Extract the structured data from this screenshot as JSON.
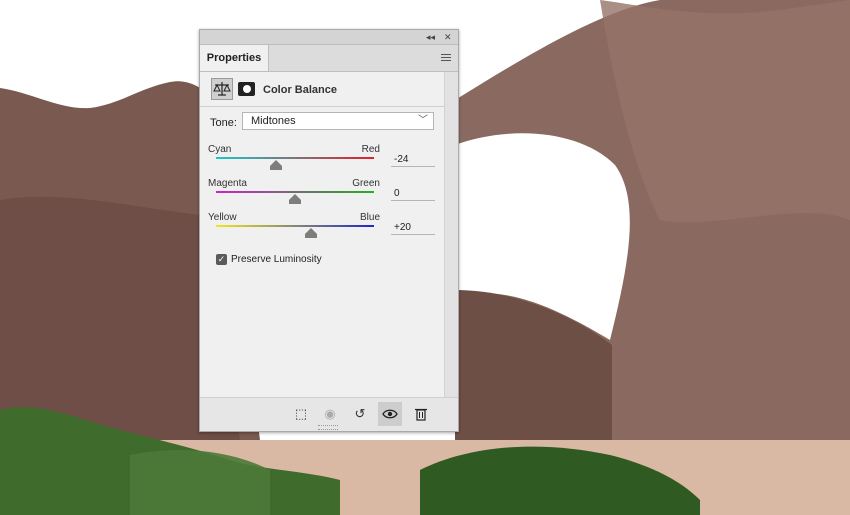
{
  "panel": {
    "tab_label": "Properties",
    "collapse_icon": "double-chevron-left-icon",
    "close_icon": "close-icon",
    "menu_icon": "panel-menu-icon",
    "adjustment_title": "Color Balance",
    "adjustment_icon": "color-balance-icon",
    "mask_icon": "layer-mask-icon"
  },
  "tone": {
    "label": "Tone:",
    "value": "Midtones"
  },
  "sliders": [
    {
      "left": "Cyan",
      "right": "Red",
      "value": "-24",
      "level": -24,
      "gradient": [
        "#19c8c8",
        "#e0202a"
      ]
    },
    {
      "left": "Magenta",
      "right": "Green",
      "value": "0",
      "level": 0,
      "gradient": [
        "#d21ed2",
        "#1eb41e"
      ]
    },
    {
      "left": "Yellow",
      "right": "Blue",
      "value": "+20",
      "level": 20,
      "gradient": [
        "#f0e61e",
        "#1e28c8"
      ]
    }
  ],
  "preserve": {
    "label": "Preserve Luminosity",
    "checked": true
  },
  "bottom_buttons": [
    {
      "icon": "clip-to-layer-icon",
      "glyph": "⬚"
    },
    {
      "icon": "view-previous-state-icon",
      "glyph": "◉"
    },
    {
      "icon": "reset-icon",
      "glyph": "↺"
    },
    {
      "icon": "toggle-visibility-icon",
      "glyph": "👁"
    },
    {
      "icon": "delete-icon",
      "glyph": "🗑"
    }
  ]
}
